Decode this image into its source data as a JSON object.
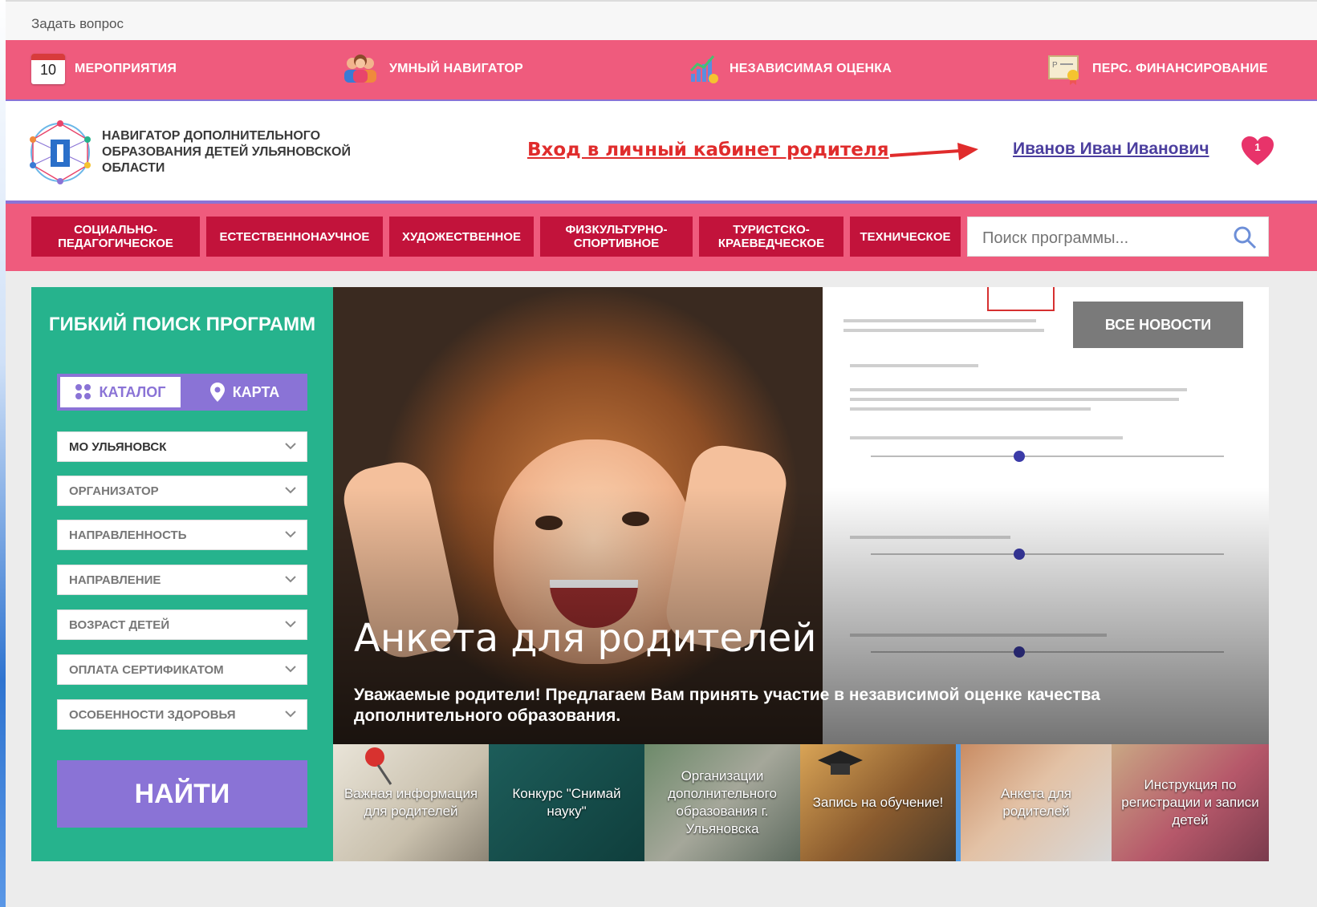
{
  "top": {
    "ask_question": "Задать вопрос"
  },
  "services": {
    "calendar_day": "10",
    "events": "МЕРОПРИЯТИЯ",
    "navigator": "УМНЫЙ НАВИГАТОР",
    "assessment": "НЕЗАВИСИМАЯ ОЦЕНКА",
    "financing": "ПЕРС. ФИНАНСИРОВАНИЕ"
  },
  "header": {
    "logo_text": "НАВИГАТОР ДОПОЛНИТЕЛЬНОГО ОБРАЗОВАНИЯ ДЕТЕЙ УЛЬЯНОВСКОЙ ОБЛАСТИ",
    "login_hint": "Вход в личный кабинет родителя",
    "user_name": "Иванов Иван Иванович",
    "favorites_count": "1"
  },
  "nav": {
    "items": [
      "СОЦИАЛЬНО-ПЕДАГОГИЧЕСКОЕ",
      "ЕСТЕСТВЕННОНАУЧНОЕ",
      "ХУДОЖЕСТВЕННОЕ",
      "ФИЗКУЛЬТУРНО-СПОРТИВНОЕ",
      "ТУРИСТСКО-КРАЕВЕДЧЕСКОЕ",
      "ТЕХНИЧЕСКОЕ"
    ],
    "search_placeholder": "Поиск программы..."
  },
  "filter": {
    "title": "ГИБКИЙ ПОИСК ПРОГРАММ",
    "catalog": "КАТАЛОГ",
    "map": "КАРТА",
    "selects": [
      "МО УЛЬЯНОВСК",
      "ОРГАНИЗАТОР",
      "НАПРАВЛЕННОСТЬ",
      "НАПРАВЛЕНИЕ",
      "ВОЗРАСТ ДЕТЕЙ",
      "ОПЛАТА СЕРТИФИКАТОМ",
      "ОСОБЕННОСТИ ЗДОРОВЬЯ"
    ],
    "find": "НАЙТИ"
  },
  "slider": {
    "news_button": "ВСЕ НОВОСТИ",
    "title": "Анкета для родителей",
    "text": "Уважаемые родители! Предлагаем Вам принять участие в независимой оценке качества дополнительного образования."
  },
  "thumbs": [
    "Важная информация для родителей",
    "Конкурс \"Снимай науку\"",
    "Организации дополнительного образования г. Ульяновска",
    "Запись на обучение!",
    "Анкета для родителей",
    "Инструкция по регистрации и записи детей"
  ],
  "colors": {
    "pink": "#ef5b7d",
    "crimson": "#c2133b",
    "purple": "#8a73d6",
    "green": "#26b38d"
  }
}
